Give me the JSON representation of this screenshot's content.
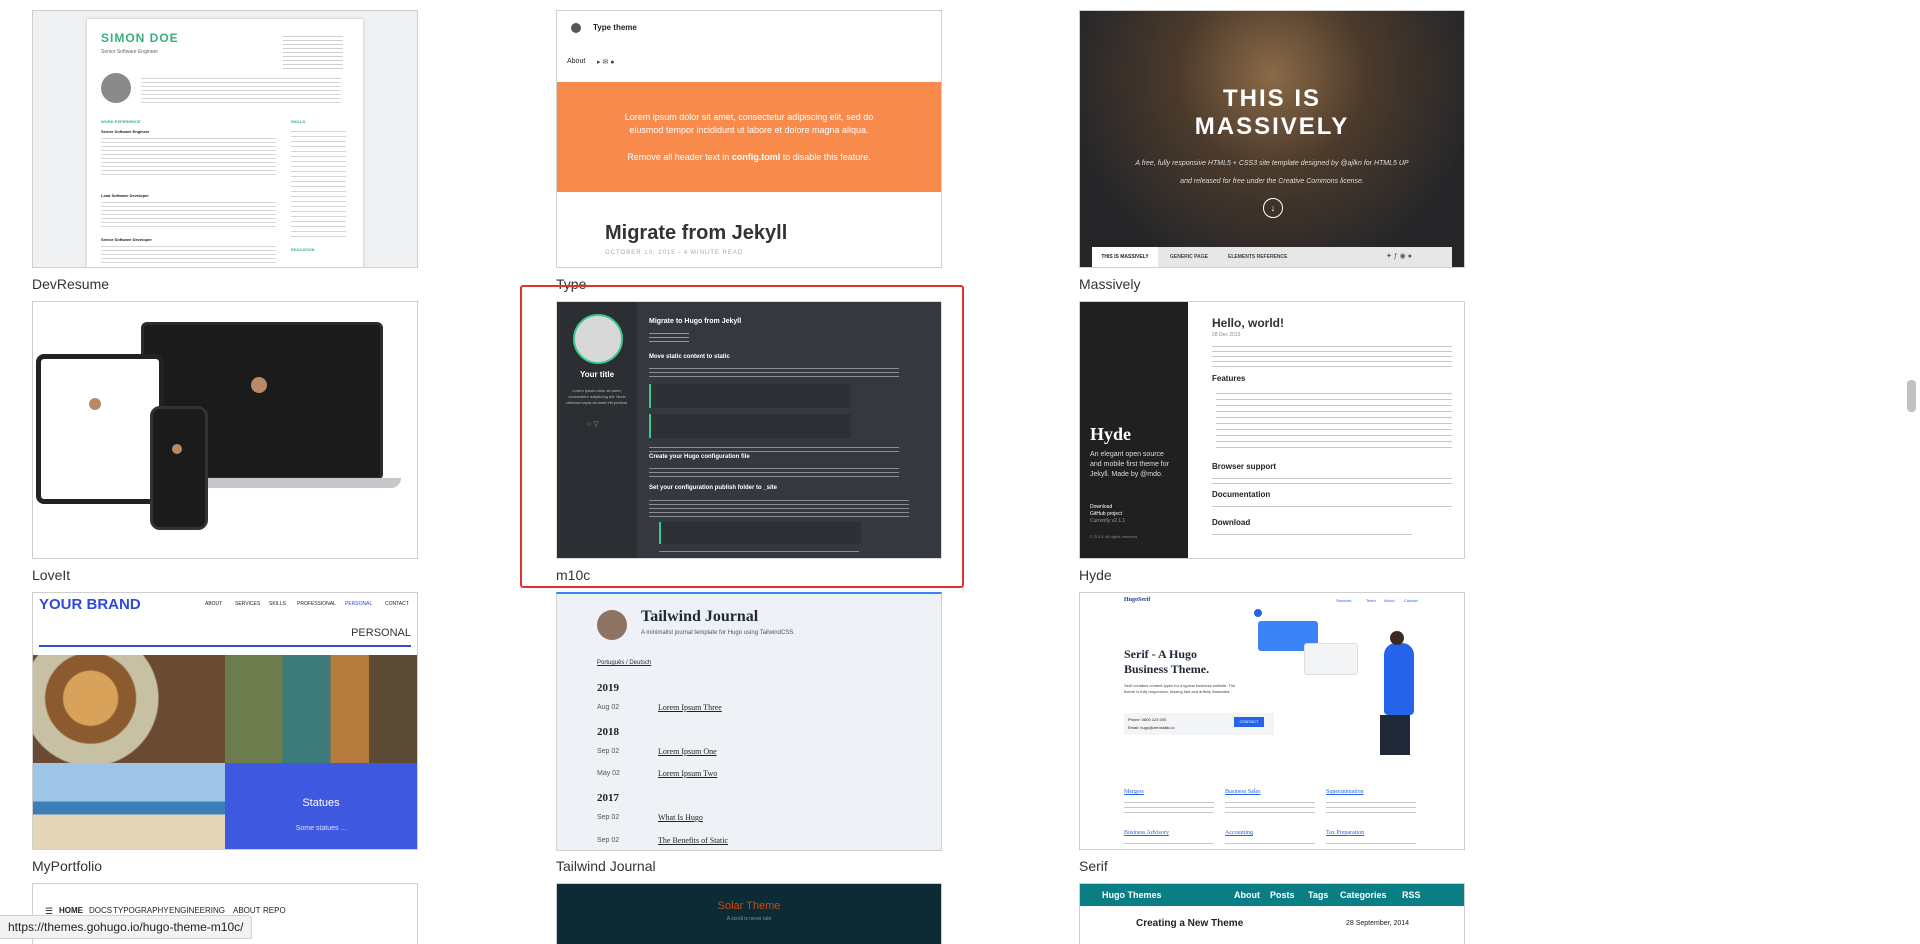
{
  "gallery": {
    "themes": [
      {
        "name": "DevResume"
      },
      {
        "name": "Type"
      },
      {
        "name": "Massively"
      },
      {
        "name": "LoveIt"
      },
      {
        "name": "m10c"
      },
      {
        "name": "Hyde"
      },
      {
        "name": "MyPortfolio"
      },
      {
        "name": "Tailwind Journal"
      },
      {
        "name": "Serif"
      }
    ]
  },
  "devresume": {
    "name": "SIMON DOE",
    "role": "Senior Software Engineer",
    "section_work": "WORK EXPERIENCE",
    "section_skills": "SKILLS",
    "section_education": "EDUCATION",
    "job1": "Senior Software Engineer",
    "job2": "Lead Software Developer",
    "job3": "Senior Software Developer"
  },
  "type_theme": {
    "header": "Type theme",
    "nav_about": "About",
    "banner_line1": "Lorem ipsum dolor sit amet, consectetur adipiscing elit, sed do eiusmod tempor incididunt ut labore et dolore magna aliqua.",
    "banner_line2_pre": "Remove all header text in ",
    "banner_line2_bold": "config.toml",
    "banner_line2_post": " to disable this feature.",
    "post_title": "Migrate from Jekyll",
    "post_meta": "OCTOBER 10, 2015 · 4 MINUTE READ"
  },
  "massively": {
    "title_line1": "THIS IS",
    "title_line2": "MASSIVELY",
    "desc1": "A free, fully responsive HTML5 + CSS3 site template designed by @ajlkn for HTML5 UP",
    "desc2": "and released for free under the Creative Commons license.",
    "nav": [
      "THIS IS MASSIVELY",
      "GENERIC PAGE",
      "ELEMENTS REFERENCE"
    ]
  },
  "m10c": {
    "your_title": "Your title",
    "bio": "Lorem ipsum dolor sit amet, consectetur adipiscing elit. Nunc vehicula turpis sit amet elit pretium.",
    "post_title": "Migrate to Hugo from Jekyll",
    "h_move": "Move static content to static",
    "h_create": "Create your Hugo configuration file",
    "h_publish": "Set your configuration publish folder to _site"
  },
  "hyde": {
    "sidebar_title": "Hyde",
    "sidebar_desc": "An elegant open source and mobile first theme for Jekyll. Made by @mdo.",
    "links": [
      "Download",
      "GitHub project",
      "Currently v2.1.1"
    ],
    "copyright": "© 2014. All rights reserved.",
    "post_title": "Hello, world!",
    "post_date": "28 Dec 2013",
    "h_features": "Features",
    "h_browser": "Browser support",
    "h_docs": "Documentation",
    "h_download": "Download"
  },
  "myportfolio": {
    "brand": "YOUR BRAND",
    "nav": [
      "ABOUT",
      "SERVICES",
      "SKILLS",
      "PROFESSIONAL",
      "PERSONAL",
      "CONTACT"
    ],
    "section": "PERSONAL",
    "tile_title": "Statues",
    "tile_sub": "Some statues ..."
  },
  "tailwind_journal": {
    "title": "Tailwind Journal",
    "subtitle": "A minimalist journal template for Hugo using TailwindCSS.",
    "langs": "Português / Deutsch",
    "years": [
      {
        "year": "2019",
        "posts": [
          {
            "date": "Aug 02",
            "title": "Lorem Ipsum Three"
          }
        ]
      },
      {
        "year": "2018",
        "posts": [
          {
            "date": "Sep 02",
            "title": "Lorem Ipsum One"
          },
          {
            "date": "May 02",
            "title": "Lorem Ipsum Two"
          }
        ]
      },
      {
        "year": "2017",
        "posts": [
          {
            "date": "Sep 02",
            "title": "What Is Hugo"
          },
          {
            "date": "Sep 02",
            "title": "The Benefits of Static"
          }
        ]
      }
    ]
  },
  "serif": {
    "logo": "HugoSerif",
    "nav": [
      "Services",
      "Team",
      "About",
      "Contact"
    ],
    "headline": "Serif - A Hugo Business Theme.",
    "desc": "Serif contains content types for a typical business website. The theme is fully responsive, blazing fast and artfully illustrated.",
    "phone": "Phone: 0800 123 000",
    "email": "Email: hugo@zerostatic.io",
    "contact_btn": "CONTACT",
    "services": [
      "Mergers",
      "Business Sales",
      "Superannuation",
      "Business Advisory",
      "Accounting",
      "Tax Preparation"
    ]
  },
  "row4": {
    "nav": [
      "HOME",
      "DOCS",
      "TYPOGRAPHY",
      "ENGINEERING",
      "ABOUT",
      "REPO"
    ],
    "solar_title": "Solar Theme",
    "solar_sub": "A scroll is never late",
    "hugo_nav_brand": "Hugo Themes",
    "hugo_nav": [
      "About",
      "Posts",
      "Tags",
      "Categories",
      "RSS"
    ],
    "hugo_post": "Creating a New Theme",
    "hugo_date": "28 September, 2014"
  },
  "status_url": "https://themes.gohugo.io/hugo-theme-m10c/"
}
